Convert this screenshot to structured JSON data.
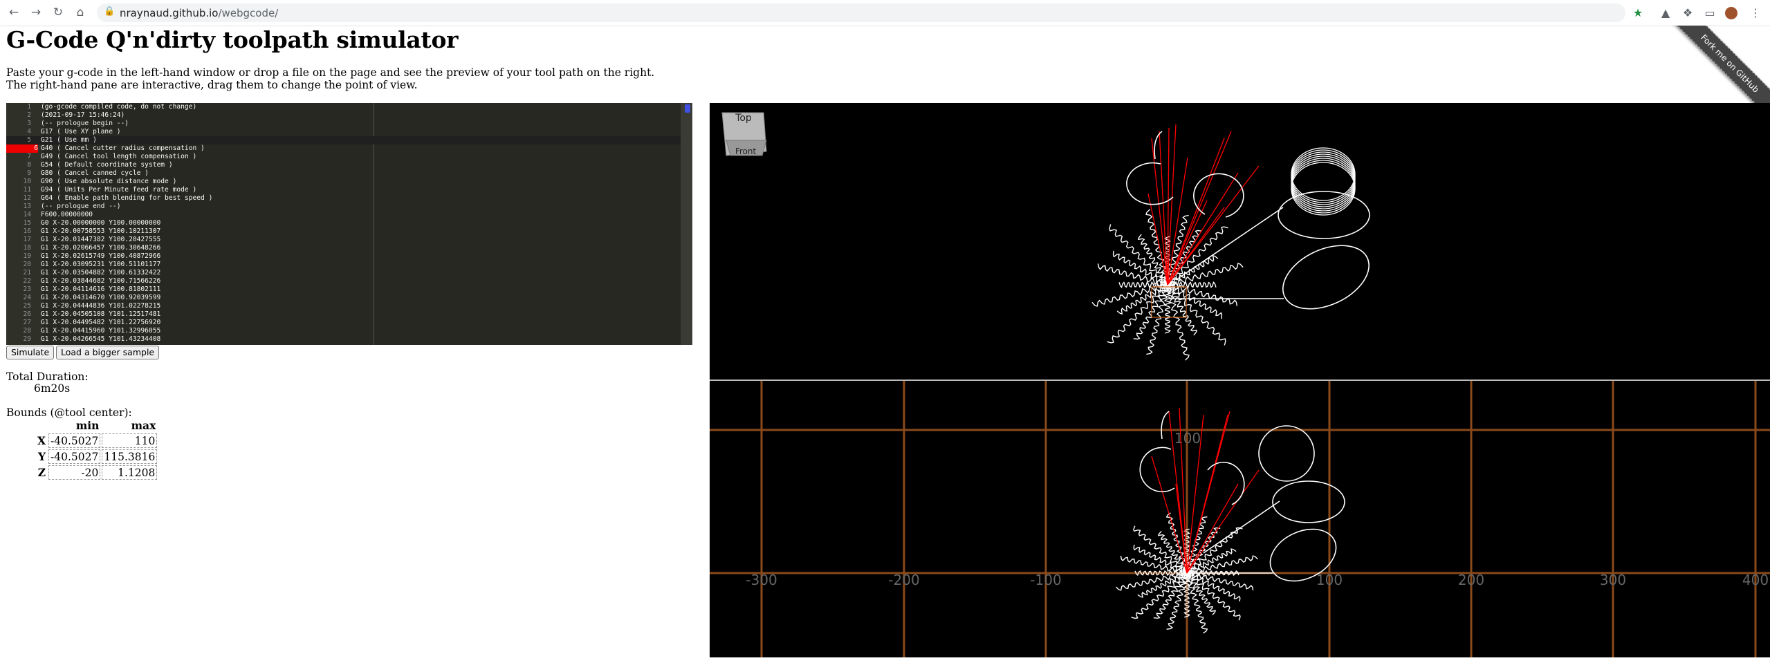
{
  "browser": {
    "url_host": "nraynaud.github.io",
    "url_path": "/webgcode/"
  },
  "page": {
    "title": "G-Code Q'n'dirty toolpath simulator",
    "intro_line1": "Paste your g-code in the left-hand window or drop a file on the page and see the preview of your tool path on the right.",
    "intro_line2": "The right-hand pane are interactive, drag them to change the point of view.",
    "ribbon": "Fork me on GitHub"
  },
  "editor": {
    "lines": [
      {
        "n": "1",
        "text": "(go-gcode compiled code, do not change)"
      },
      {
        "n": "2",
        "text": "(2021-09-17 15:46:24)"
      },
      {
        "n": "3",
        "text": "(-- prologue begin --)"
      },
      {
        "n": "4",
        "text": "G17 ( Use XY plane )"
      },
      {
        "n": "5",
        "text": "G21 ( Use mm )"
      },
      {
        "n": "6",
        "text": "G40 ( Cancel cutter radius compensation )"
      },
      {
        "n": "7",
        "text": "G49 ( Cancel tool length compensation )"
      },
      {
        "n": "8",
        "text": "G54 ( Default coordinate system )"
      },
      {
        "n": "9",
        "text": "G80 ( Cancel canned cycle )"
      },
      {
        "n": "10",
        "text": "G90 ( Use absolute distance mode )"
      },
      {
        "n": "11",
        "text": "G94 ( Units Per Minute feed rate mode )"
      },
      {
        "n": "12",
        "text": "G64 ( Enable path blending for best speed )"
      },
      {
        "n": "13",
        "text": "(-- prologue end --)"
      },
      {
        "n": "14",
        "text": "F600.00000000"
      },
      {
        "n": "15",
        "text": "G0 X-20.00000000 Y100.00000000"
      },
      {
        "n": "16",
        "text": "G1 X-20.00758553 Y100.10211307"
      },
      {
        "n": "17",
        "text": "G1 X-20.01447382 Y100.20427555"
      },
      {
        "n": "18",
        "text": "G1 X-20.02066457 Y100.30648266"
      },
      {
        "n": "19",
        "text": "G1 X-20.02615749 Y100.40872966"
      },
      {
        "n": "20",
        "text": "G1 X-20.03095231 Y100.51101177"
      },
      {
        "n": "21",
        "text": "G1 X-20.03504882 Y100.61332422"
      },
      {
        "n": "22",
        "text": "G1 X-20.03844682 Y100.71566226"
      },
      {
        "n": "23",
        "text": "G1 X-20.04114616 Y100.81802111"
      },
      {
        "n": "24",
        "text": "G1 X-20.04314670 Y100.92039599"
      },
      {
        "n": "25",
        "text": "G1 X-20.04444836 Y101.02278215"
      },
      {
        "n": "26",
        "text": "G1 X-20.04505108 Y101.12517481"
      },
      {
        "n": "27",
        "text": "G1 X-20.04495482 Y101.22756920"
      },
      {
        "n": "28",
        "text": "G1 X-20.04415960 Y101.32996055"
      },
      {
        "n": "29",
        "text": "G1 X-20.04266545 Y101.43234408"
      }
    ]
  },
  "buttons": {
    "simulate": "Simulate",
    "load_sample": "Load a bigger sample"
  },
  "stats": {
    "total_duration_label": "Total Duration:",
    "total_duration_value": "6m20s",
    "bounds_label": "Bounds (@tool center):",
    "col_min": "min",
    "col_max": "max",
    "rows": [
      {
        "axis": "X",
        "min": "-40.5027",
        "max": "110"
      },
      {
        "axis": "Y",
        "min": "-40.5027",
        "max": "115.3816"
      },
      {
        "axis": "Z",
        "min": "-20",
        "max": "1.1208"
      }
    ]
  },
  "view_top": {
    "cube_top_label": "Top",
    "cube_front_label": "Front"
  },
  "view_front": {
    "x_axis_labels": [
      "-300",
      "-200",
      "-100",
      "100",
      "200",
      "300",
      "400"
    ],
    "y_axis_label": "100"
  },
  "colors": {
    "editor_bg": "#272822",
    "error_marker": "#e00000",
    "grid": "#8a4a1a",
    "rapid_move": "#ff0000",
    "feed_move": "#ffffff"
  }
}
